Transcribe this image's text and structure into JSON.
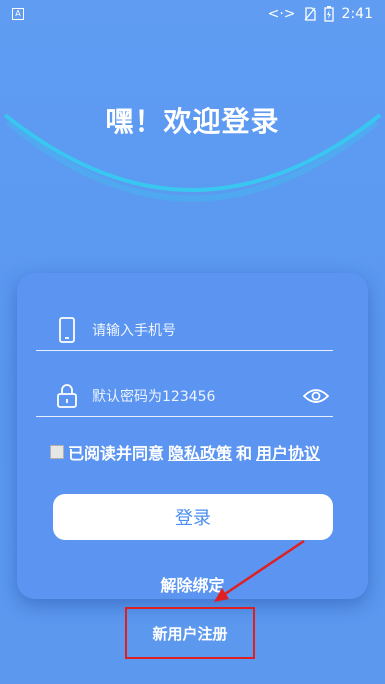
{
  "status_bar": {
    "left_icon": "A",
    "time": "2:41",
    "icons": [
      "code-icon",
      "no-sim-icon",
      "battery-charging-icon"
    ]
  },
  "header": {
    "title": "嘿！欢迎登录"
  },
  "form": {
    "phone_placeholder": "请输入手机号",
    "password_placeholder": "默认密码为123456",
    "agree_prefix": "已阅读并同意",
    "privacy_link": "隐私政策",
    "and_text": "和",
    "agreement_link": "用户协议",
    "login_label": "登录",
    "unbind_label": "解除绑定"
  },
  "footer": {
    "register_label": "新用户注册"
  },
  "colors": {
    "background": "#5f9cf2",
    "card": "#5b95f1",
    "arc": "#39c6f0",
    "button_text": "#4a8ef0",
    "highlight_box": "#e02020"
  }
}
